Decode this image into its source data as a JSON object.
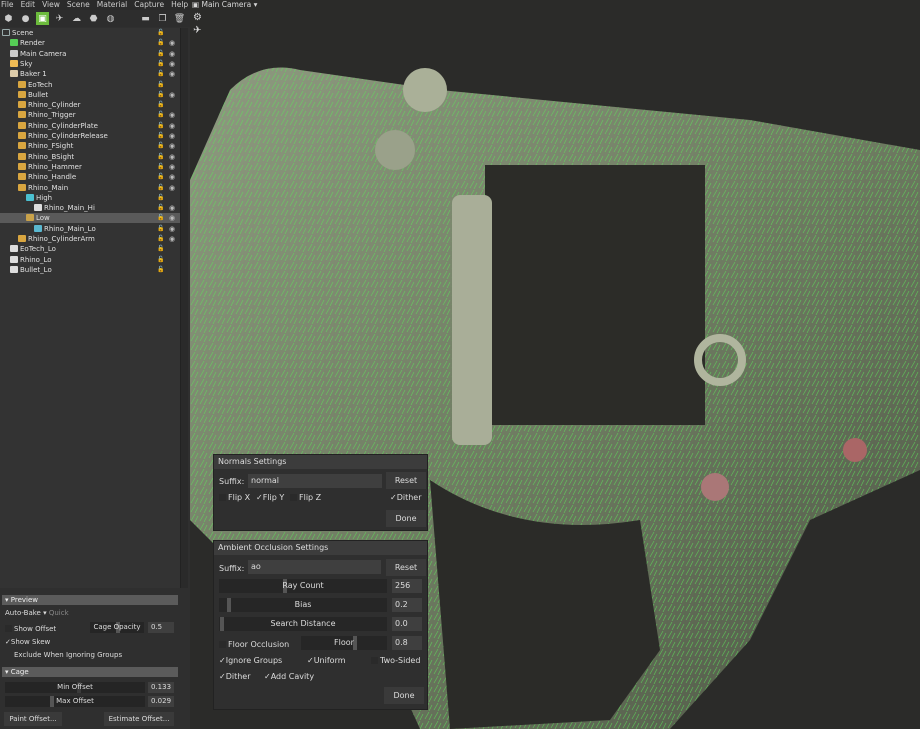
{
  "menu": [
    "File",
    "Edit",
    "View",
    "Scene",
    "Material",
    "Capture",
    "Help"
  ],
  "toolbar": [
    {
      "icon": "cube-icon",
      "glyph": "⬢"
    },
    {
      "icon": "light-icon",
      "glyph": "●"
    },
    {
      "icon": "baker-icon",
      "glyph": "▣",
      "active": true
    },
    {
      "icon": "turntable-icon",
      "glyph": "✈"
    },
    {
      "icon": "shadow-catcher-icon",
      "glyph": "☁"
    },
    {
      "icon": "box-icon",
      "glyph": "⬣"
    },
    {
      "icon": "sphere-icon",
      "glyph": "◍"
    },
    {
      "icon": "folder-icon",
      "glyph": "▬"
    },
    {
      "icon": "duplicate-icon",
      "glyph": "❐"
    },
    {
      "icon": "delete-icon",
      "glyph": "🗑"
    }
  ],
  "camera": {
    "label": "Main Camera"
  },
  "tree": [
    {
      "label": "Scene",
      "depth": 0,
      "icon": "scene-icon",
      "color": "#9aa",
      "eye": false,
      "lock": true
    },
    {
      "label": "Render",
      "depth": 1,
      "icon": "render-icon",
      "color": "#5c5",
      "eye": true,
      "lock": true
    },
    {
      "label": "Main Camera",
      "depth": 1,
      "icon": "camera-icon",
      "color": "#ccc",
      "eye": true,
      "lock": true
    },
    {
      "label": "Sky",
      "depth": 1,
      "icon": "sky-icon",
      "color": "#eb5",
      "eye": true,
      "lock": true
    },
    {
      "label": "Baker 1",
      "depth": 1,
      "icon": "baker-icon",
      "color": "#dca",
      "eye": true,
      "lock": true
    },
    {
      "label": "EoTech",
      "depth": 2,
      "icon": "folder-icon",
      "color": "#d9a640",
      "eye": false,
      "lock": true
    },
    {
      "label": "Bullet",
      "depth": 2,
      "icon": "folder-icon",
      "color": "#d9a640",
      "eye": true,
      "lock": true
    },
    {
      "label": "Rhino_Cylinder",
      "depth": 2,
      "icon": "folder-icon",
      "color": "#d9a640",
      "eye": false,
      "lock": true
    },
    {
      "label": "Rhino_Trigger",
      "depth": 2,
      "icon": "folder-icon",
      "color": "#d9a640",
      "eye": true,
      "lock": true
    },
    {
      "label": "Rhino_CylinderPlate",
      "depth": 2,
      "icon": "folder-icon",
      "color": "#d9a640",
      "eye": true,
      "lock": true
    },
    {
      "label": "Rhino_CylinderRelease",
      "depth": 2,
      "icon": "folder-icon",
      "color": "#d9a640",
      "eye": true,
      "lock": true
    },
    {
      "label": "Rhino_FSight",
      "depth": 2,
      "icon": "folder-icon",
      "color": "#d9a640",
      "eye": true,
      "lock": true
    },
    {
      "label": "Rhino_BSight",
      "depth": 2,
      "icon": "folder-icon",
      "color": "#d9a640",
      "eye": true,
      "lock": true
    },
    {
      "label": "Rhino_Hammer",
      "depth": 2,
      "icon": "folder-icon",
      "color": "#d9a640",
      "eye": true,
      "lock": true
    },
    {
      "label": "Rhino_Handle",
      "depth": 2,
      "icon": "folder-icon",
      "color": "#d9a640",
      "eye": true,
      "lock": true
    },
    {
      "label": "Rhino_Main",
      "depth": 2,
      "icon": "folder-icon",
      "color": "#d9a640",
      "eye": true,
      "lock": true
    },
    {
      "label": "High",
      "depth": 3,
      "icon": "high-group-icon",
      "color": "#4bc0d0",
      "eye": false,
      "lock": true
    },
    {
      "label": "Rhino_Main_Hi",
      "depth": 4,
      "icon": "mesh-icon",
      "color": "#ddd",
      "eye": true,
      "lock": true
    },
    {
      "label": "Low",
      "depth": 3,
      "icon": "low-group-icon",
      "color": "#c9a24a",
      "eye": true,
      "lock": true,
      "selected": true
    },
    {
      "label": "Rhino_Main_Lo",
      "depth": 4,
      "icon": "mesh-icon",
      "color": "#5ab8d0",
      "eye": true,
      "lock": true
    },
    {
      "label": "Rhino_CylinderArm",
      "depth": 2,
      "icon": "folder-icon",
      "color": "#d9a640",
      "eye": true,
      "lock": true
    },
    {
      "label": "EoTech_Lo",
      "depth": 1,
      "icon": "mesh-icon",
      "color": "#ddd",
      "eye": false,
      "lock": true
    },
    {
      "label": "Rhino_Lo",
      "depth": 1,
      "icon": "mesh-icon",
      "color": "#ddd",
      "eye": false,
      "lock": true
    },
    {
      "label": "Bullet_Lo",
      "depth": 1,
      "icon": "mesh-icon",
      "color": "#ddd",
      "eye": false,
      "lock": true
    }
  ],
  "preview": {
    "title": "Preview",
    "auto_bake": "Auto-Bake",
    "auto_bake_mode": "Quick",
    "show_offset": "Show Offset",
    "show_offset_checked": false,
    "cage_opacity_label": "Cage Opacity",
    "cage_opacity": "0.5",
    "cage_opacity_fraction": 0.5,
    "show_skew": "Show Skew",
    "show_skew_checked": true,
    "exclude": "Exclude When Ignoring Groups",
    "exclude_checked": false
  },
  "cage": {
    "title": "Cage",
    "min_offset_label": "Min Offset",
    "min_offset": "0.133",
    "max_offset_label": "Max Offset",
    "max_offset": "0.029",
    "paint_offset": "Paint Offset...",
    "estimate_offset": "Estimate Offset..."
  },
  "normals": {
    "title": "Normals Settings",
    "suffix_label": "Suffix:",
    "suffix": "normal",
    "reset": "Reset",
    "flip_x": "Flip X",
    "flip_y": "Flip Y",
    "flip_z": "Flip Z",
    "dither": "Dither",
    "done": "Done",
    "flip_x_checked": false,
    "flip_y_checked": true,
    "flip_z_checked": false,
    "dither_checked": true
  },
  "ao": {
    "title": "Ambient Occlusion Settings",
    "suffix_label": "Suffix:",
    "suffix": "ao",
    "reset": "Reset",
    "ray_count_label": "Ray Count",
    "ray_count": "256",
    "bias_label": "Bias",
    "bias": "0.2",
    "search_label": "Search Distance",
    "search": "0.0",
    "floor_occlusion": "Floor Occlusion",
    "floor_occlusion_checked": false,
    "floor_label": "Floor",
    "floor": "0.8",
    "ignore_groups": "Ignore Groups",
    "uniform": "Uniform",
    "two_sided": "Two-Sided",
    "dither": "Dither",
    "add_cavity": "Add Cavity",
    "done": "Done"
  },
  "colors": {
    "accent": "#6cbb3c",
    "normals_overlay": "#4ce04c"
  }
}
